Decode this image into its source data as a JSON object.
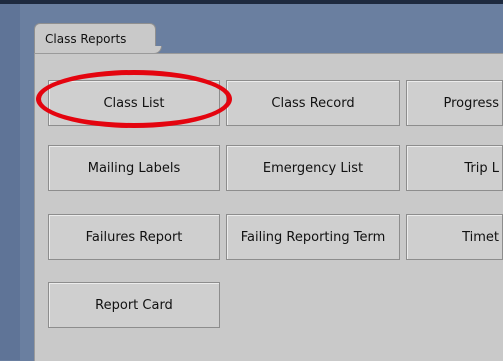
{
  "tab": {
    "label": "Class Reports"
  },
  "buttons": {
    "row1": [
      "Class List",
      "Class Record",
      "Progress"
    ],
    "row2": [
      "Mailing Labels",
      "Emergency List",
      "Trip L"
    ],
    "row3": [
      "Failures Report",
      "Failing Reporting Term",
      "Timet"
    ],
    "row4": [
      "Report Card"
    ]
  },
  "highlight": {
    "color": "#e4040f",
    "target": "Class List"
  }
}
